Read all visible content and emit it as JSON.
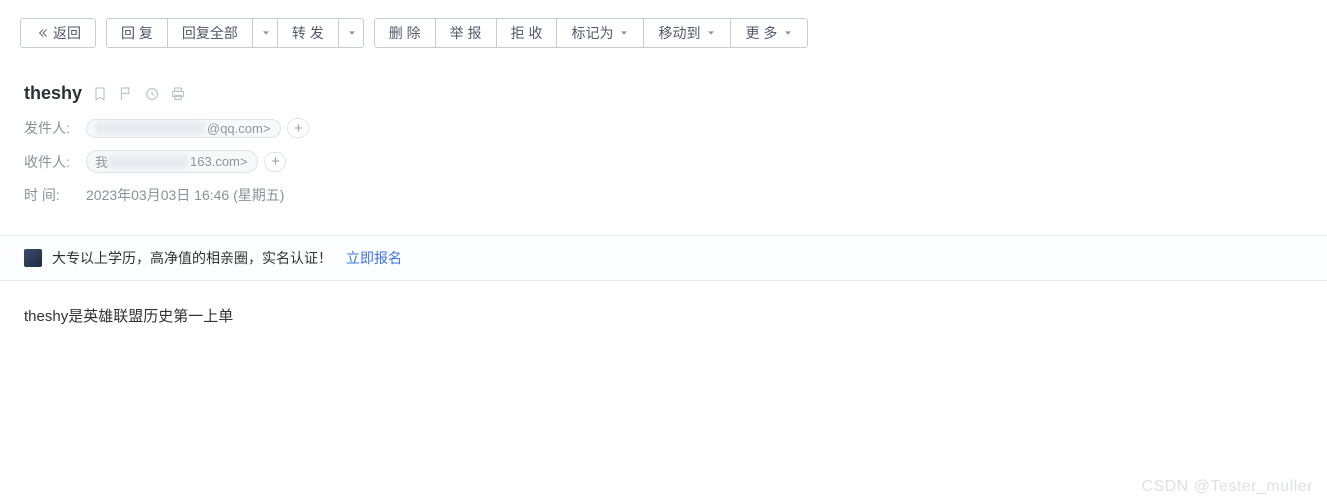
{
  "toolbar": {
    "back": "返回",
    "reply": "回 复",
    "reply_all": "回复全部",
    "forward": "转 发",
    "delete": "删 除",
    "report": "举 报",
    "reject": "拒 收",
    "mark_as": "标记为",
    "move_to": "移动到",
    "more": "更 多"
  },
  "mail": {
    "subject": "theshy",
    "sender_label": "发件人:",
    "sender_domain": "@qq.com>",
    "recipient_label": "收件人:",
    "recipient_prefix": "我",
    "recipient_domain": "163.com>",
    "time_label": "时   间:",
    "time_value": "2023年03月03日 16:46 (星期五)"
  },
  "ad": {
    "text": "大专以上学历，高净值的相亲圈，实名认证！",
    "link": "立即报名"
  },
  "body": {
    "content": "theshy是英雄联盟历史第一上单"
  },
  "watermark": "CSDN @Tester_muller"
}
